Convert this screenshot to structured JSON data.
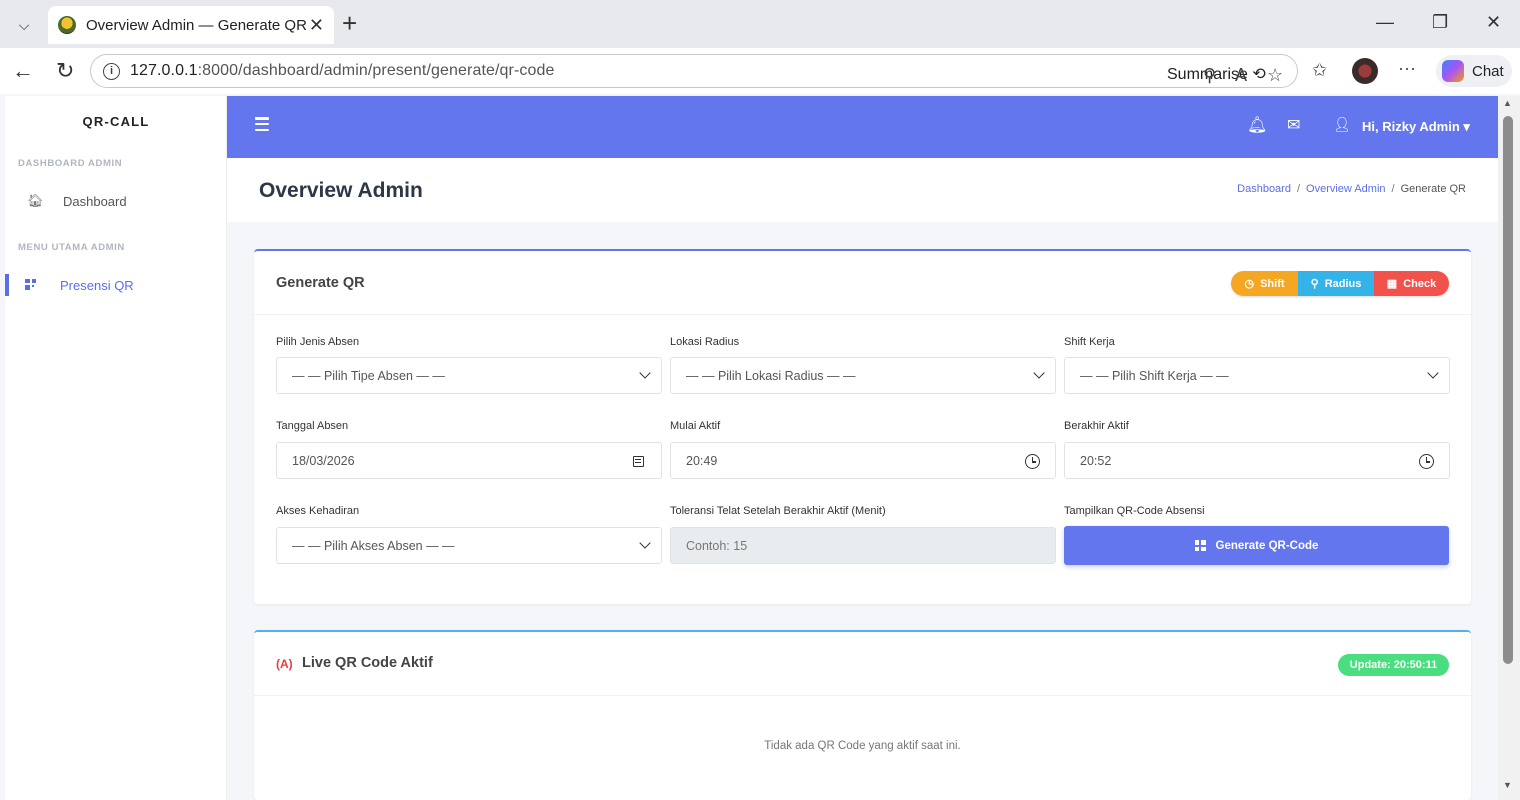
{
  "browser": {
    "tab_title": "Overview Admin — Generate QR",
    "url_host": "127.0.0.1",
    "url_rest": ":8000/dashboard/admin/present/generate/qr-code",
    "summarise_label": "Summarise",
    "chat_label": "Chat"
  },
  "sidebar": {
    "brand": "QR-CALL",
    "section1": "DASHBOARD ADMIN",
    "item_dashboard": "Dashboard",
    "section2": "MENU UTAMA ADMIN",
    "item_presensi": "Presensi QR",
    "active_color": "#5b6ee8"
  },
  "topnav": {
    "user_label": "Hi, Rizky Admin",
    "bg_color": "#6476ee"
  },
  "header": {
    "title": "Overview Admin",
    "breadcrumb": [
      "Dashboard",
      "Overview Admin",
      "Generate QR"
    ],
    "breadcrumb_sep": "/"
  },
  "generate_card": {
    "title": "Generate QR",
    "btn_shift": "Shift",
    "btn_radius": "Radius",
    "btn_check": "Check",
    "fields": {
      "jenis_label": "Pilih Jenis Absen",
      "jenis_value": "— — Pilih Tipe Absen — —",
      "lokasi_label": "Lokasi Radius",
      "lokasi_value": "— — Pilih Lokasi Radius — —",
      "shift_label": "Shift Kerja",
      "shift_value": "— — Pilih Shift Kerja — —",
      "tanggal_label": "Tanggal Absen",
      "tanggal_value": "18/03/2026",
      "mulai_label": "Mulai Aktif",
      "mulai_value": "20:49",
      "berakhir_label": "Berakhir Aktif",
      "berakhir_value": "20:52",
      "akses_label": "Akses Kehadiran",
      "akses_value": "— — Pilih Akses Absen — —",
      "toleransi_label": "Toleransi Telat Setelah Berakhir Aktif (Menit)",
      "toleransi_placeholder": "Contoh: 15",
      "tampilkan_label": "Tampilkan QR-Code Absensi"
    },
    "generate_button": "Generate QR-Code"
  },
  "live_card": {
    "icon": "(A)",
    "title": "Live QR Code Aktif",
    "update_badge": "Update: 20:50:11",
    "empty_message": "Tidak ada QR Code yang aktif saat ini."
  }
}
